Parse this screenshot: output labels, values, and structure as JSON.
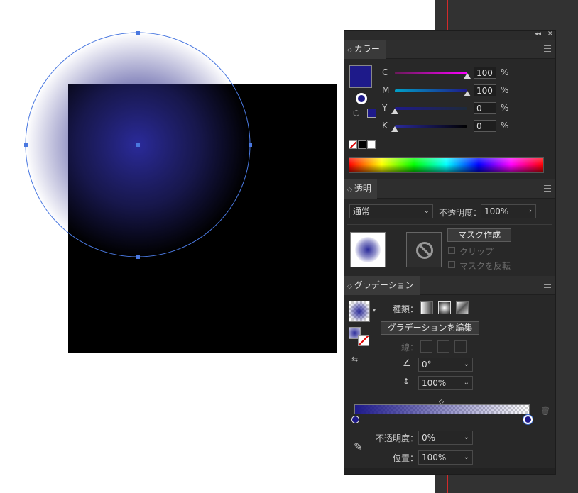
{
  "colors": {
    "accent_blue": "#1e1a8a",
    "selection_blue": "#3b6fd8",
    "panel_bg": "#282828"
  },
  "panel": {
    "collapse_label": "◂◂",
    "close_label": "✕"
  },
  "color_panel": {
    "tab_label": "カラー",
    "channels": [
      {
        "label": "C",
        "value": "100",
        "unit": "%",
        "level": 1.0
      },
      {
        "label": "M",
        "value": "100",
        "unit": "%",
        "level": 1.0
      },
      {
        "label": "Y",
        "value": "0",
        "unit": "%",
        "level": 0.0
      },
      {
        "label": "K",
        "value": "0",
        "unit": "%",
        "level": 0.0
      }
    ]
  },
  "transparency_panel": {
    "tab_label": "透明",
    "blend_mode": "通常",
    "opacity_label": "不透明度：",
    "opacity_value": "100%",
    "make_mask_button": "マスク作成",
    "clip_label": "クリップ",
    "invert_mask_label": "マスクを反転"
  },
  "gradient_panel": {
    "tab_label": "グラデーション",
    "type_label": "種類：",
    "edit_button": "グラデーションを編集",
    "stroke_label": "線：",
    "angle_value": "0°",
    "aspect_value": "100%",
    "stop_opacity_label": "不透明度：",
    "stop_opacity_value": "0%",
    "location_label": "位置：",
    "location_value": "100%"
  }
}
